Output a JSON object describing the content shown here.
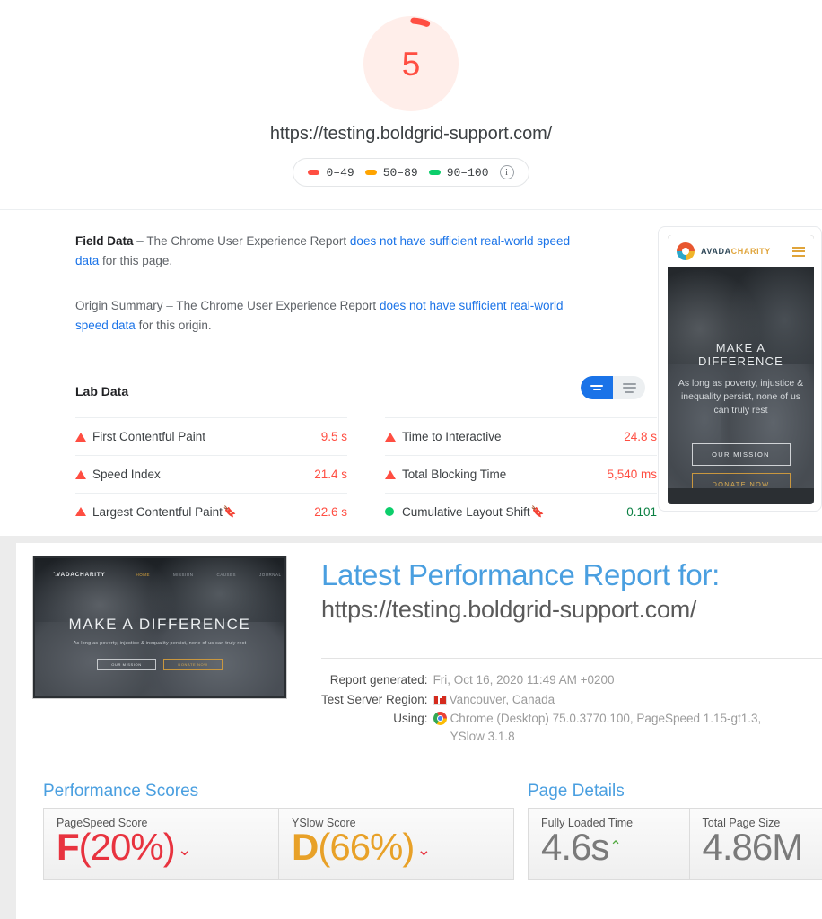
{
  "pagespeed": {
    "score": "5",
    "score_color": "#ff4e42",
    "url": "https://testing.boldgrid-support.com/",
    "legend": [
      {
        "label": "0–49",
        "color": "#ff4e42",
        "icon": "square-red-icon"
      },
      {
        "label": "50–89",
        "color": "#ffa400",
        "icon": "square-orange-icon"
      },
      {
        "label": "90–100",
        "color": "#0cce6b",
        "icon": "square-green-icon"
      }
    ],
    "info_icon": "info-icon",
    "field_data": {
      "title": "Field Data",
      "dash": "–",
      "text_before": "The Chrome User Experience Report",
      "link_text": "does not have sufficient real-world speed data",
      "text_after": "for this page."
    },
    "origin_summary": {
      "title": "Origin Summary",
      "dash": "–",
      "text_before": "The Chrome User Experience Report",
      "link_text": "does not have sufficient real-world speed data",
      "text_after": "for this origin."
    },
    "lab_data": {
      "title": "Lab Data",
      "toggle_active": "condensed-view",
      "toggle_inactive": "expanded-view",
      "left_column": [
        {
          "label": "First Contentful Paint",
          "value": "9.5 s",
          "status": "bad",
          "flag": false
        },
        {
          "label": "Speed Index",
          "value": "21.4 s",
          "status": "bad",
          "flag": false
        },
        {
          "label": "Largest Contentful Paint",
          "value": "22.6 s",
          "status": "bad",
          "flag": true
        }
      ],
      "right_column": [
        {
          "label": "Time to Interactive",
          "value": "24.8 s",
          "status": "bad",
          "flag": false
        },
        {
          "label": "Total Blocking Time",
          "value": "5,540 ms",
          "status": "bad",
          "flag": false
        },
        {
          "label": "Cumulative Layout Shift",
          "value": "0.101",
          "status": "good",
          "flag": true
        }
      ]
    },
    "thumbnail": {
      "brand_first": "AVADA",
      "brand_second": "CHARITY",
      "headline": "MAKE A DIFFERENCE",
      "subtext": "As long as poverty, injustice & inequality persist, none of us can truly rest",
      "button_primary": "OUR MISSION",
      "button_secondary": "DONATE NOW"
    }
  },
  "gtmetrix": {
    "thumbnail": {
      "brand_first": "AVADA",
      "brand_second": "CHARITY",
      "nav": [
        "HOME",
        "MISSION",
        "CAUSES",
        "JOURNAL"
      ],
      "headline": "MAKE A DIFFERENCE",
      "subtext": "As long as poverty, injustice & inequality persist, none of us can truly rest",
      "button_primary": "OUR MISSION",
      "button_secondary": "DONATE NOW"
    },
    "title_line1": "Latest Performance Report for:",
    "title_line2": "https://testing.boldgrid-support.com/",
    "meta": [
      {
        "key": "Report generated:",
        "value": "Fri, Oct 16, 2020 11:49 AM +0200",
        "icon": ""
      },
      {
        "key": "Test Server Region:",
        "value": "Vancouver, Canada",
        "icon": "canada-flag-icon"
      },
      {
        "key": "Using:",
        "value": "Chrome (Desktop) 75.0.3770.100, PageSpeed 1.15-gt1.3,",
        "value2": "YSlow 3.1.8",
        "icon": "chrome-icon"
      }
    ],
    "performance_scores": {
      "title": "Performance Scores",
      "cells": [
        {
          "label": "PageSpeed Score",
          "grade": "F",
          "percent": "(20%)",
          "color": "#e8333f",
          "caret": "caret-down-icon"
        },
        {
          "label": "YSlow Score",
          "grade": "D",
          "percent": "(66%)",
          "color": "#e8a128",
          "caret": "caret-down-icon"
        }
      ]
    },
    "page_details": {
      "title": "Page Details",
      "cells": [
        {
          "label": "Fully Loaded Time",
          "value": "4.6s",
          "caret": "caret-up-icon",
          "caret_color": "#4fa83d"
        },
        {
          "label": "Total Page Size",
          "value": "4.86M",
          "caret": "",
          "caret_color": ""
        }
      ]
    }
  }
}
